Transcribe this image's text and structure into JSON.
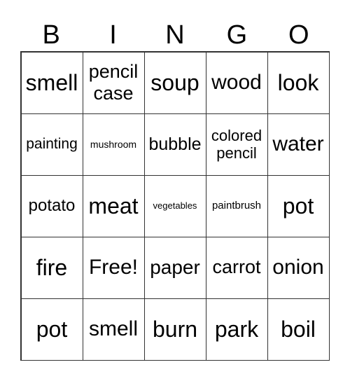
{
  "header": [
    "B",
    "I",
    "N",
    "G",
    "O"
  ],
  "cells": [
    {
      "text": "smell",
      "size": 32
    },
    {
      "text": "pencil case",
      "size": 27
    },
    {
      "text": "soup",
      "size": 32
    },
    {
      "text": "wood",
      "size": 30
    },
    {
      "text": "look",
      "size": 32
    },
    {
      "text": "painting",
      "size": 21
    },
    {
      "text": "mushroom",
      "size": 14
    },
    {
      "text": "bubble",
      "size": 25
    },
    {
      "text": "colored pencil",
      "size": 22
    },
    {
      "text": "water",
      "size": 30
    },
    {
      "text": "potato",
      "size": 24
    },
    {
      "text": "meat",
      "size": 32
    },
    {
      "text": "vegetables",
      "size": 13
    },
    {
      "text": "paintbrush",
      "size": 15
    },
    {
      "text": "pot",
      "size": 32
    },
    {
      "text": "fire",
      "size": 32
    },
    {
      "text": "Free!",
      "size": 30
    },
    {
      "text": "paper",
      "size": 28
    },
    {
      "text": "carrot",
      "size": 27
    },
    {
      "text": "onion",
      "size": 30
    },
    {
      "text": "pot",
      "size": 32
    },
    {
      "text": "smell",
      "size": 30
    },
    {
      "text": "burn",
      "size": 32
    },
    {
      "text": "park",
      "size": 32
    },
    {
      "text": "boil",
      "size": 32
    }
  ]
}
